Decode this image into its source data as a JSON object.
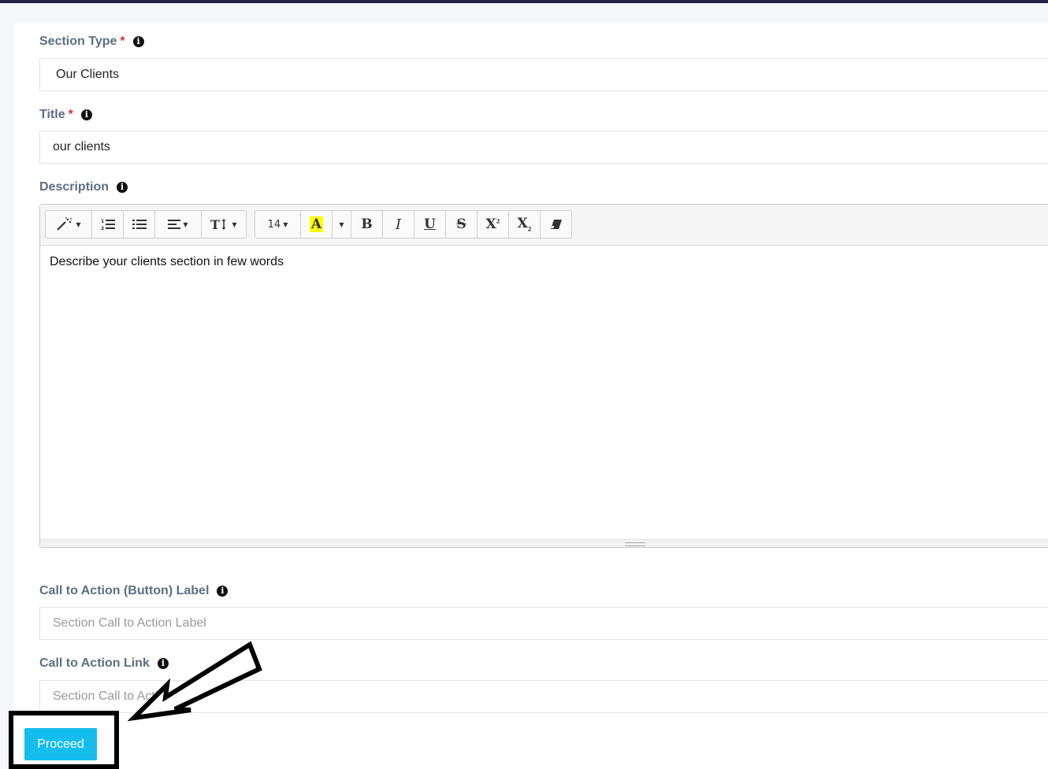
{
  "form": {
    "section_type": {
      "label": "Section Type",
      "required_mark": "*",
      "value": "Our Clients"
    },
    "title": {
      "label": "Title",
      "required_mark": "*",
      "value": "our clients"
    },
    "description": {
      "label": "Description",
      "content": "Describe your clients section in few words",
      "toolbar": {
        "font_size": "14",
        "color_letter": "A",
        "bold": "B",
        "italic": "I",
        "underline": "U",
        "strike": "S",
        "superscript": "X",
        "subscript": "X"
      }
    },
    "cta_label": {
      "label": "Call to Action (Button) Label",
      "placeholder": "Section Call to Action Label"
    },
    "cta_link": {
      "label": "Call to Action Link",
      "placeholder": "Section Call to Action Link"
    },
    "proceed_label": "Proceed"
  },
  "info_glyph": "i",
  "colors": {
    "accent": "#15bdef",
    "label": "#5c6f82",
    "required": "#d9302c",
    "top_bar": "#26214a"
  }
}
